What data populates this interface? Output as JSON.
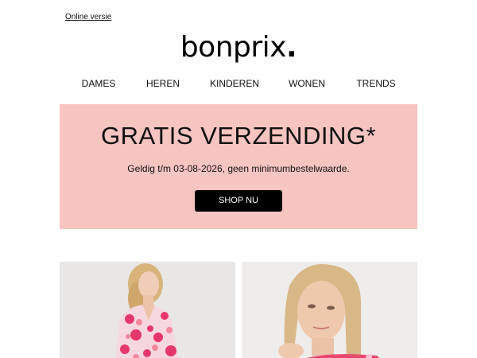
{
  "header": {
    "online_link": "Online versie",
    "logo_text": "bonprix",
    "logo_dot": "."
  },
  "nav": {
    "items": [
      {
        "label": "DAMES"
      },
      {
        "label": "HEREN"
      },
      {
        "label": "KINDEREN"
      },
      {
        "label": "WONEN"
      },
      {
        "label": "TRENDS"
      }
    ]
  },
  "banner": {
    "title": "GRATIS VERZENDING*",
    "subtitle": "Geldig t/m 03-08-2026, geen minimumbestelwaarde.",
    "button_label": "SHOP NU",
    "background_color": "#f6c4c1"
  },
  "products": [
    {
      "image": "woman-pink-floral-dress-photo"
    },
    {
      "image": "woman-blonde-portrait-photo"
    }
  ]
}
